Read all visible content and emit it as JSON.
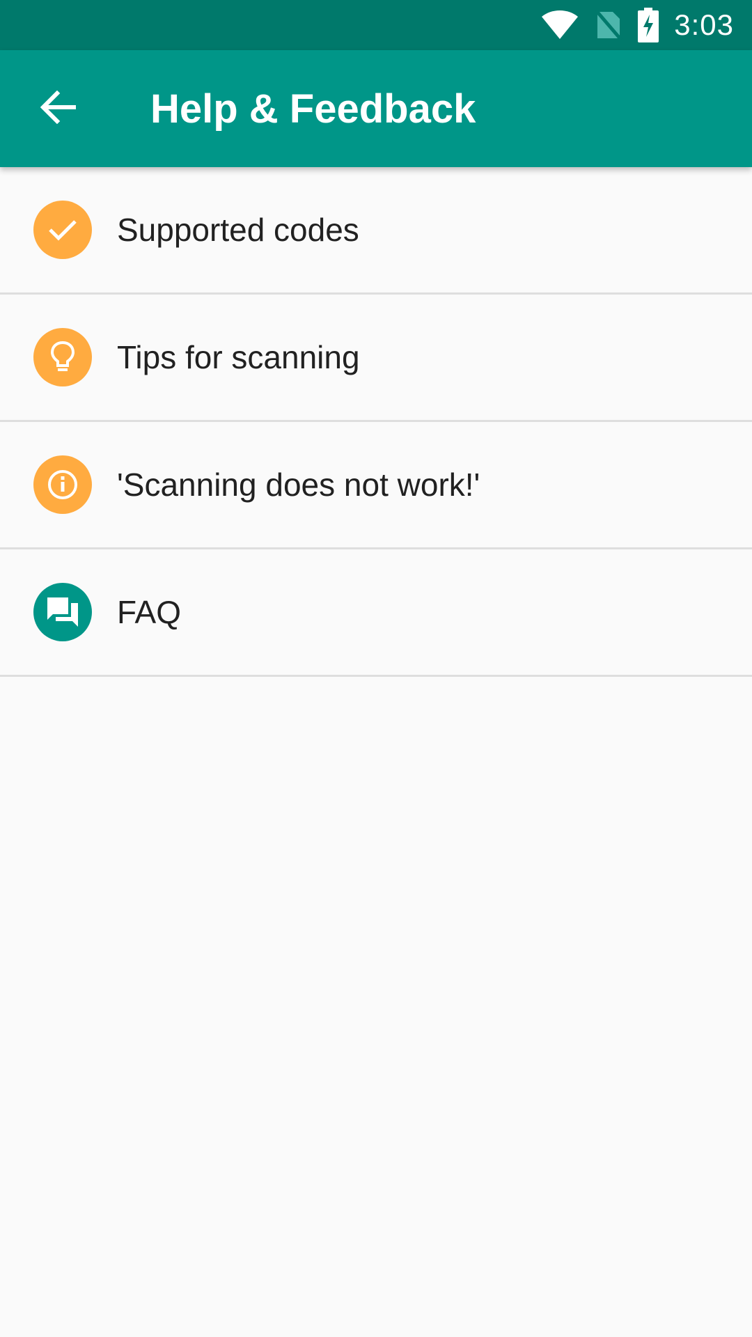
{
  "status_bar": {
    "time": "3:03",
    "icons": [
      "wifi-icon",
      "no-sim-icon",
      "battery-charging-icon"
    ]
  },
  "app_bar": {
    "back_icon": "arrow-back-icon",
    "title": "Help & Feedback"
  },
  "menu": {
    "items": [
      {
        "label": "Supported codes",
        "icon": "check-icon",
        "color": "#ffab40"
      },
      {
        "label": "Tips for scanning",
        "icon": "lightbulb-icon",
        "color": "#ffab40"
      },
      {
        "label": "'Scanning does not work!'",
        "icon": "info-icon",
        "color": "#ffab40"
      },
      {
        "label": "FAQ",
        "icon": "forum-icon",
        "color": "#009688"
      }
    ]
  },
  "colors": {
    "status_bar": "#00796b",
    "app_bar": "#009688",
    "accent_orange": "#ffab40",
    "background": "#fafafa",
    "divider": "#dedede"
  }
}
